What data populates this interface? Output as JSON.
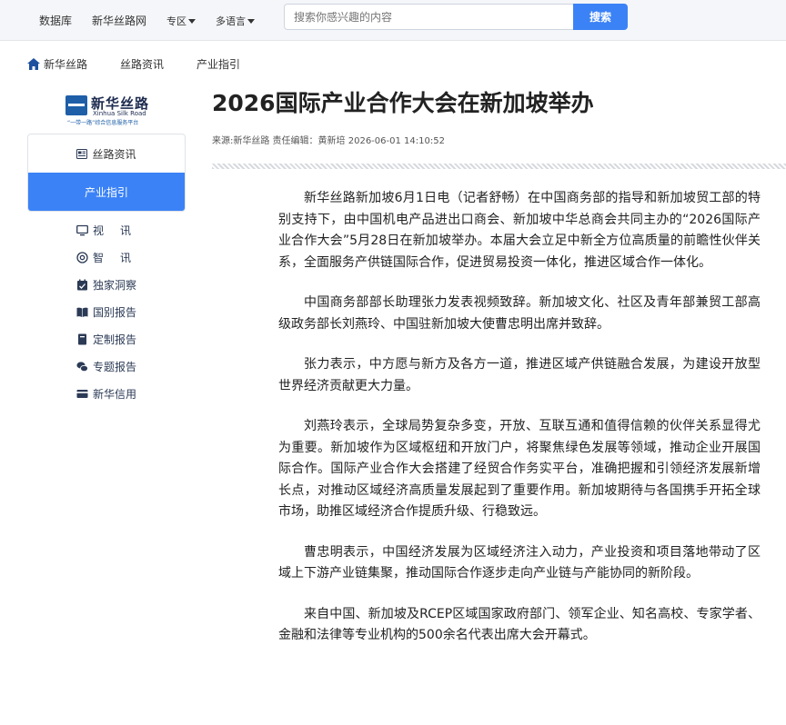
{
  "topnav": {
    "items": [
      "数据库",
      "新华丝路网",
      "专区",
      "多语言"
    ],
    "search_placeholder": "搜索你感兴趣的内容",
    "search_button": "搜索"
  },
  "breadcrumb": [
    "新华丝路",
    "丝路资讯",
    "产业指引"
  ],
  "logo": {
    "title": "新华丝路",
    "english": "Xinhua Silk Road",
    "subtitle": "“一带一路”综合信息服务平台"
  },
  "sidebar": {
    "tabs": [
      "丝路资讯",
      "产业指引"
    ],
    "active_tab": "产业指引",
    "items": [
      "视讯",
      "智讯",
      "独家洞察",
      "国别报告",
      "定制报告",
      "专题报告",
      "新华信用"
    ]
  },
  "article": {
    "title": "2026国际产业合作大会在新加坡举办",
    "meta": "来源:新华丝路 责任编辑：黄新培 2026-06-01 14:10:52",
    "paragraphs": [
      "新华丝路新加坡6月1日电（记者舒畅）在中国商务部的指导和新加坡贸工部的特别支持下，由中国机电产品进出口商会、新加坡中华总商会共同主办的“2026国际产业合作大会”5月28日在新加坡举办。本届大会立足中新全方位高质量的前瞻性伙伴关系，全面服务产供链国际合作，促进贸易投资一体化，推进区域合作一体化。",
      "中国商务部部长助理张力发表视频致辞。新加坡文化、社区及青年部兼贸工部高级政务部长刘燕玲、中国驻新加坡大使曹忠明出席并致辞。",
      "张力表示，中方愿与新方及各方一道，推进区域产供链融合发展，为建设开放型世界经济贡献更大力量。",
      "刘燕玲表示，全球局势复杂多变，开放、互联互通和值得信赖的伙伴关系显得尤为重要。新加坡作为区域枢纽和开放门户，将聚焦绿色发展等领域，推动企业开展国际合作。国际产业合作大会搭建了经贸合作务实平台，准确把握和引领经济发展新增长点，对推动区域经济高质量发展起到了重要作用。新加坡期待与各国携手开拓全球市场，助推区域经济合作提质升级、行稳致远。",
      "曹忠明表示，中国经济发展为区域经济注入动力，产业投资和项目落地带动了区域上下游产业链集聚，推动国际合作逐步走向产业链与产能协同的新阶段。",
      "来自中国、新加坡及RCEP区域国家政府部门、领军企业、知名高校、专家学者、金融和法律等专业机构的500余名代表出席大会开幕式。"
    ]
  },
  "colors": {
    "accent": "#3b82f6",
    "nav_text": "#2b3a55",
    "logo_blue": "#1e5fa8"
  }
}
